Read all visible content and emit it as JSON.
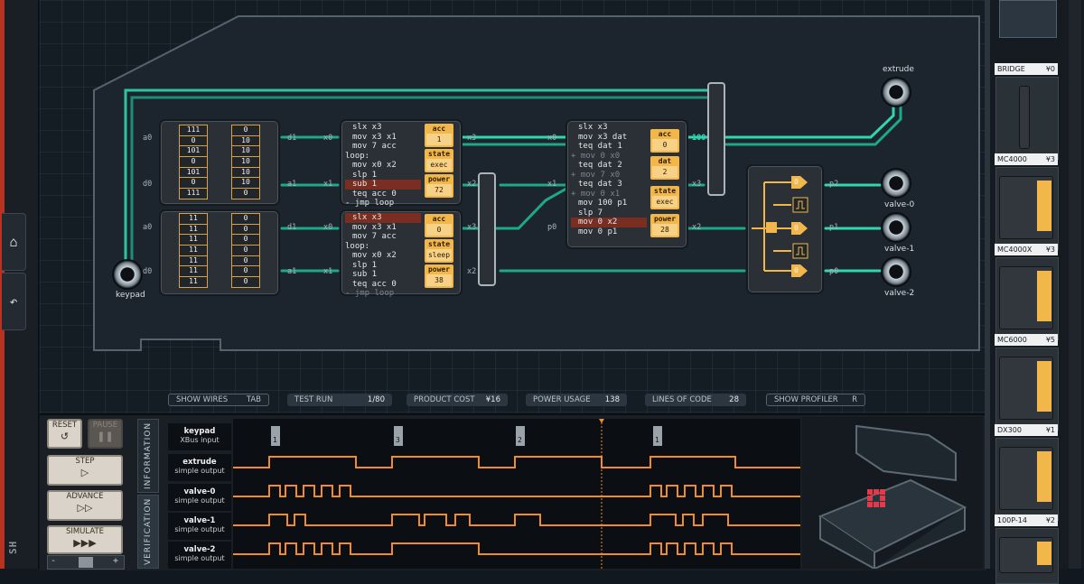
{
  "board": {
    "ports": {
      "keypad": "keypad",
      "extrude": "extrude",
      "valve0": "valve-0",
      "valve1": "valve-1",
      "valve2": "valve-2"
    },
    "rom_top": {
      "left": [
        "111",
        "0",
        "101",
        "0",
        "101",
        "0",
        "111"
      ],
      "right": [
        "0",
        "10",
        "10",
        "10",
        "10",
        "10",
        "0"
      ]
    },
    "rom_bottom": {
      "left": [
        "11",
        "11",
        "11",
        "11",
        "11",
        "11",
        "11"
      ],
      "right": [
        "0",
        "0",
        "0",
        "0",
        "0",
        "0",
        "0"
      ]
    },
    "pins": {
      "a0": "a0",
      "d0": "d0",
      "a1": "a1",
      "d1": "d1",
      "x0": "x0",
      "x1": "x1",
      "x2": "x2",
      "x3": "x3",
      "p0": "p0",
      "p1": "p1",
      "p2": "p2",
      "wire_value": "100"
    },
    "mc_a": {
      "code": [
        "slx x3",
        "mov x3 x1",
        "mov 7 acc",
        "loop:",
        "mov x0 x2",
        "slp 1",
        "sub 1",
        "teq acc 0",
        "- jmp loop"
      ],
      "registers": [
        {
          "label": "acc",
          "value": "1"
        },
        {
          "label": "state",
          "value": "exec"
        },
        {
          "label": "power",
          "value": "72"
        }
      ]
    },
    "mc_b": {
      "code": [
        "slx x3",
        "mov x3 x1",
        "mov 7 acc",
        "loop:",
        "mov x0 x2",
        "slp 1",
        "sub 1",
        "teq acc 0",
        "- jmp loop"
      ],
      "registers": [
        {
          "label": "acc",
          "value": "0"
        },
        {
          "label": "state",
          "value": "sleep"
        },
        {
          "label": "power",
          "value": "38"
        }
      ]
    },
    "mc_c": {
      "code": [
        "slx x3",
        "mov x3 dat",
        "teq dat 1",
        "+ mov 0 x0",
        "teq dat 2",
        "+ mov 7 x0",
        "teq dat 3",
        "+ mov 0 x1",
        "mov 100 p1",
        "slp 7",
        "mov 0 x2",
        "mov 0 p1"
      ],
      "registers": [
        {
          "label": "acc",
          "value": "0"
        },
        {
          "label": "dat",
          "value": "2"
        },
        {
          "label": "state",
          "value": "exec"
        },
        {
          "label": "power",
          "value": "28"
        }
      ]
    },
    "logic_values": [
      "0",
      "0",
      "0"
    ]
  },
  "toolbar": {
    "show_wires": "SHOW WIRES",
    "show_wires_key": "TAB",
    "test_run": "TEST RUN",
    "test_run_val": "1/80",
    "product_cost": "PRODUCT COST",
    "product_cost_val": "¥16",
    "power_usage": "POWER USAGE",
    "power_usage_val": "138",
    "lines_of_code": "LINES OF CODE",
    "lines_of_code_val": "28",
    "show_profiler": "SHOW PROFILER",
    "show_profiler_key": "R"
  },
  "controls": {
    "reset": "RESET",
    "pause": "PAUSE",
    "step": "STEP",
    "advance": "ADVANCE",
    "simulate": "SIMULATE",
    "speed_minus": "-",
    "speed_plus": "+"
  },
  "tabs": {
    "information": "INFORMATION",
    "verification": "VERIFICATION"
  },
  "signals": [
    {
      "name": "keypad",
      "type": "XBus input"
    },
    {
      "name": "extrude",
      "type": "simple output"
    },
    {
      "name": "valve-0",
      "type": "simple output"
    },
    {
      "name": "valve-1",
      "type": "simple output"
    },
    {
      "name": "valve-2",
      "type": "simple output"
    }
  ],
  "keypad_events": [
    "1",
    "3",
    "2",
    "1"
  ],
  "parts": [
    {
      "name": "BRIDGE",
      "price": "¥0"
    },
    {
      "name": "MC4000",
      "price": "¥3"
    },
    {
      "name": "MC4000X",
      "price": "¥3"
    },
    {
      "name": "MC6000",
      "price": "¥5"
    },
    {
      "name": "DX300",
      "price": "¥1"
    },
    {
      "name": "100P-14",
      "price": "¥2"
    }
  ],
  "rail": {
    "home_icon": "home-icon",
    "undo_icon": "undo-icon",
    "brand": "SHENZHEN"
  },
  "colors": {
    "accent": "#f2b74a",
    "wire": "#2fd6b0",
    "signal": "#f08c2a",
    "highlight": "#7a2e22"
  }
}
